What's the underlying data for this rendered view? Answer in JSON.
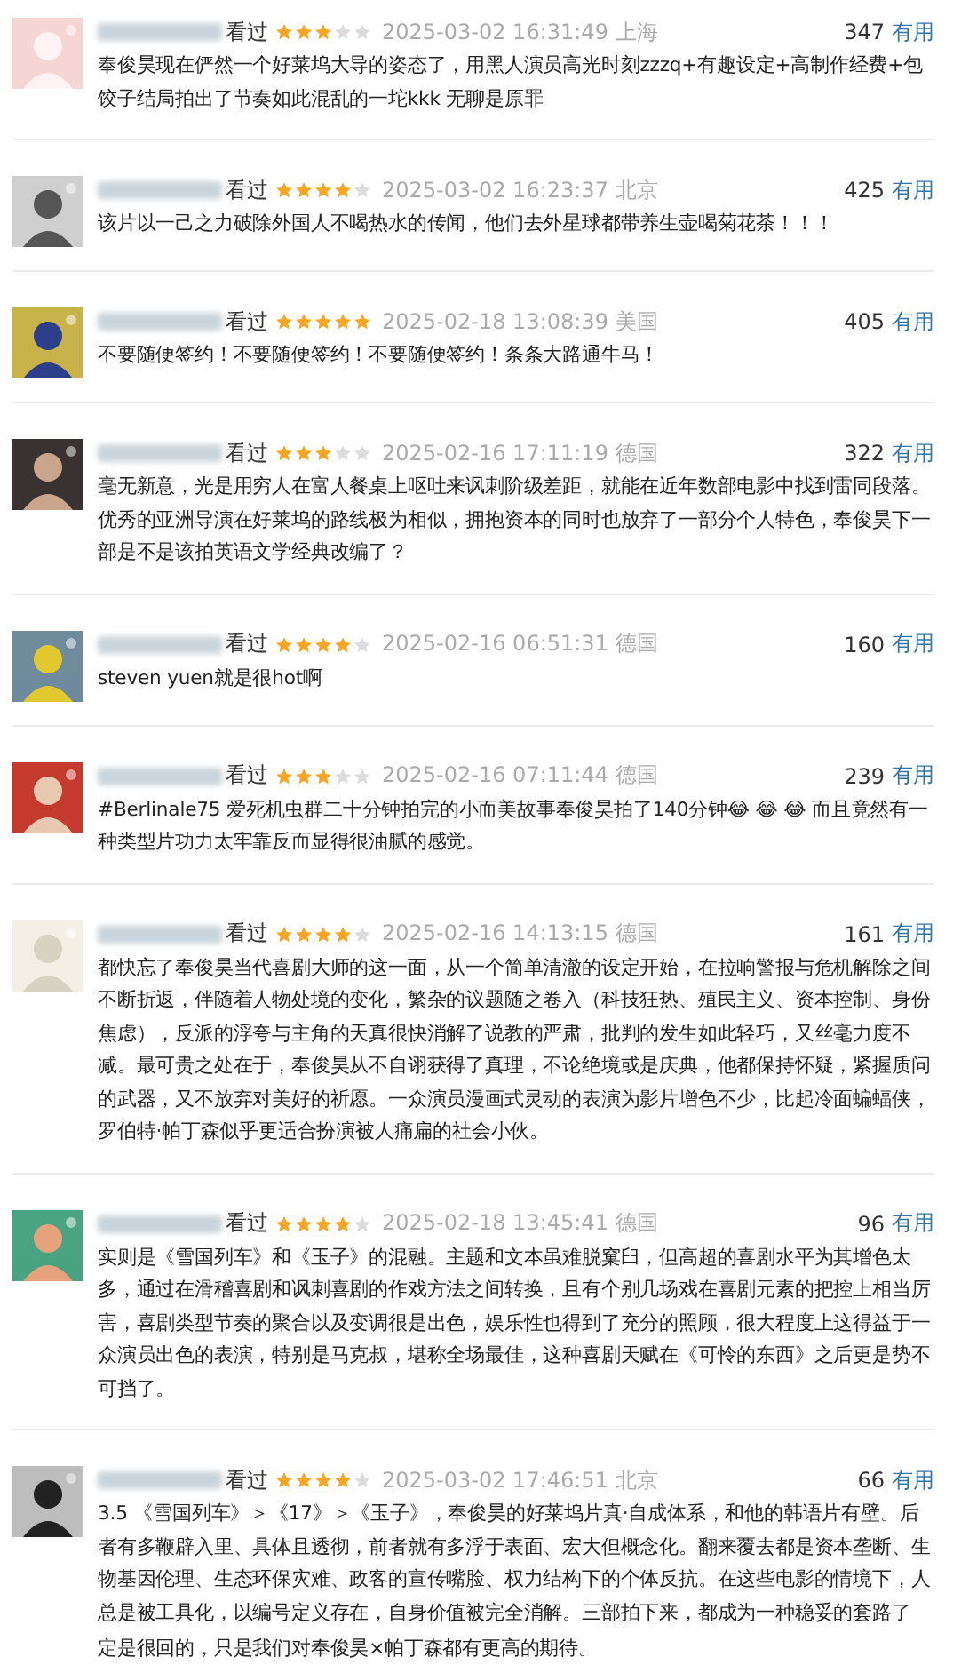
{
  "reviews": [
    {
      "status": "看过",
      "stars": 3,
      "time": "2025-03-02 16:31:49 上海",
      "votes": "347",
      "vote_label": "有用",
      "text": "奉俊昊现在俨然一个好莱坞大导的姿态了，用黑人演员高光时刻zzzq+有趣设定+高制作经费+包饺子结局拍出了节奏如此混乱的一坨kkk 无聊是原罪"
    },
    {
      "status": "看过",
      "stars": 4,
      "time": "2025-03-02 16:23:37 北京",
      "votes": "425",
      "vote_label": "有用",
      "text": "该片以一己之力破除外国人不喝热水的传闻，他们去外星球都带养生壶喝菊花茶！！！"
    },
    {
      "status": "看过",
      "stars": 5,
      "time": "2025-02-18 13:08:39 美国",
      "votes": "405",
      "vote_label": "有用",
      "text": "不要随便签约！不要随便签约！不要随便签约！条条大路通牛马！"
    },
    {
      "status": "看过",
      "stars": 3,
      "time": "2025-02-16 17:11:19 德国",
      "votes": "322",
      "vote_label": "有用",
      "text": "毫无新意，光是用穷人在富人餐桌上呕吐来讽刺阶级差距，就能在近年数部电影中找到雷同段落。优秀的亚洲导演在好莱坞的路线极为相似，拥抱资本的同时也放弃了一部分个人特色，奉俊昊下一部是不是该拍英语文学经典改编了？"
    },
    {
      "status": "看过",
      "stars": 4,
      "time": "2025-02-16 06:51:31 德国",
      "votes": "160",
      "vote_label": "有用",
      "text": "steven yuen就是很hot啊"
    },
    {
      "status": "看过",
      "stars": 3,
      "time": "2025-02-16 07:11:44 德国",
      "votes": "239",
      "vote_label": "有用",
      "text": "#Berlinale75 爱死机虫群二十分钟拍完的小而美故事奉俊昊拍了140分钟😂 😂 😂 而且竟然有一种类型片功力太牢靠反而显得很油腻的感觉。"
    },
    {
      "status": "看过",
      "stars": 4,
      "time": "2025-02-16 14:13:15 德国",
      "votes": "161",
      "vote_label": "有用",
      "text": "都快忘了奉俊昊当代喜剧大师的这一面，从一个简单清澈的设定开始，在拉响警报与危机解除之间不断折返，伴随着人物处境的变化，繁杂的议题随之卷入（科技狂热、殖民主义、资本控制、身份焦虑），反派的浮夸与主角的天真很快消解了说教的严肃，批判的发生如此轻巧，又丝毫力度不减。最可贵之处在于，奉俊昊从不自诩获得了真理，不论绝境或是庆典，他都保持怀疑，紧握质问的武器，又不放弃对美好的祈愿。一众演员漫画式灵动的表演为影片增色不少，比起冷面蝙蝠侠，罗伯特·帕丁森似乎更适合扮演被人痛扁的社会小伙。"
    },
    {
      "status": "看过",
      "stars": 4,
      "time": "2025-02-18 13:45:41 德国",
      "votes": "96",
      "vote_label": "有用",
      "text": "实则是《雪国列车》和《玉子》的混融。主题和文本虽难脱窠臼，但高超的喜剧水平为其增色太多，通过在滑稽喜剧和讽刺喜剧的作戏方法之间转换，且有个别几场戏在喜剧元素的把控上相当厉害，喜剧类型节奏的聚合以及变调很是出色，娱乐性也得到了充分的照顾，很大程度上这得益于一众演员出色的表演，特别是马克叔，堪称全场最佳，这种喜剧天赋在《可怜的东西》之后更是势不可挡了。"
    },
    {
      "status": "看过",
      "stars": 4,
      "time": "2025-03-02 17:46:51 北京",
      "votes": "66",
      "vote_label": "有用",
      "text": "3.5 《雪国列车》＞《17》＞《玉子》，奉俊昊的好莱坞片真·自成体系，和他的韩语片有壁。后者有多鞭辟入里、具体且透彻，前者就有多浮于表面、宏大但概念化。翻来覆去都是资本垄断、生物基因伦理、生态环保灾难、政客的宣传嘴脸、权力结构下的个体反抗。在这些电影的情境下，人总是被工具化，以编号定义存在，自身价值被完全消解。三部拍下来，都成为一种稳妥的套路了",
      "text_2": "定是很回的，只是我们对奉俊昊×帕丁森都有更高的期待。"
    }
  ]
}
